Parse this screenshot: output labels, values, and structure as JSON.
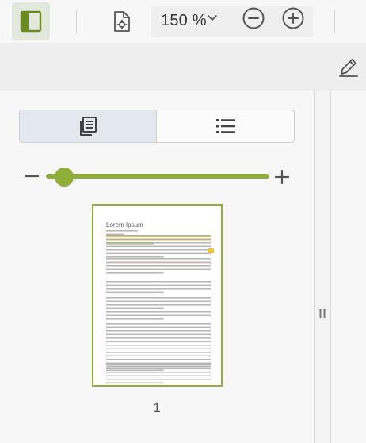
{
  "toolbar": {
    "zoom": {
      "value": "150 %"
    },
    "icons": {
      "sidebar_toggle": "sidebar-panel-icon",
      "document_settings": "document-gear-icon",
      "zoom_dropdown": "chevron-down-icon",
      "zoom_out": "minus-circle-icon",
      "zoom_in": "plus-circle-icon"
    },
    "accent_color": "#8fae3a"
  },
  "annotation_bar": {
    "icons": {
      "edit": "pencil-icon"
    }
  },
  "sidebar": {
    "view_tabs": [
      {
        "icon": "page-thumbnails-icon",
        "selected": true
      },
      {
        "icon": "outline-list-icon",
        "selected": false
      }
    ],
    "thumbnail_size": {
      "fraction": 0.08
    },
    "pages": [
      {
        "number": "1",
        "title": "Lorem Ipsum",
        "selected": true
      }
    ],
    "resize_handle_icon": "drag-handle-icon"
  }
}
